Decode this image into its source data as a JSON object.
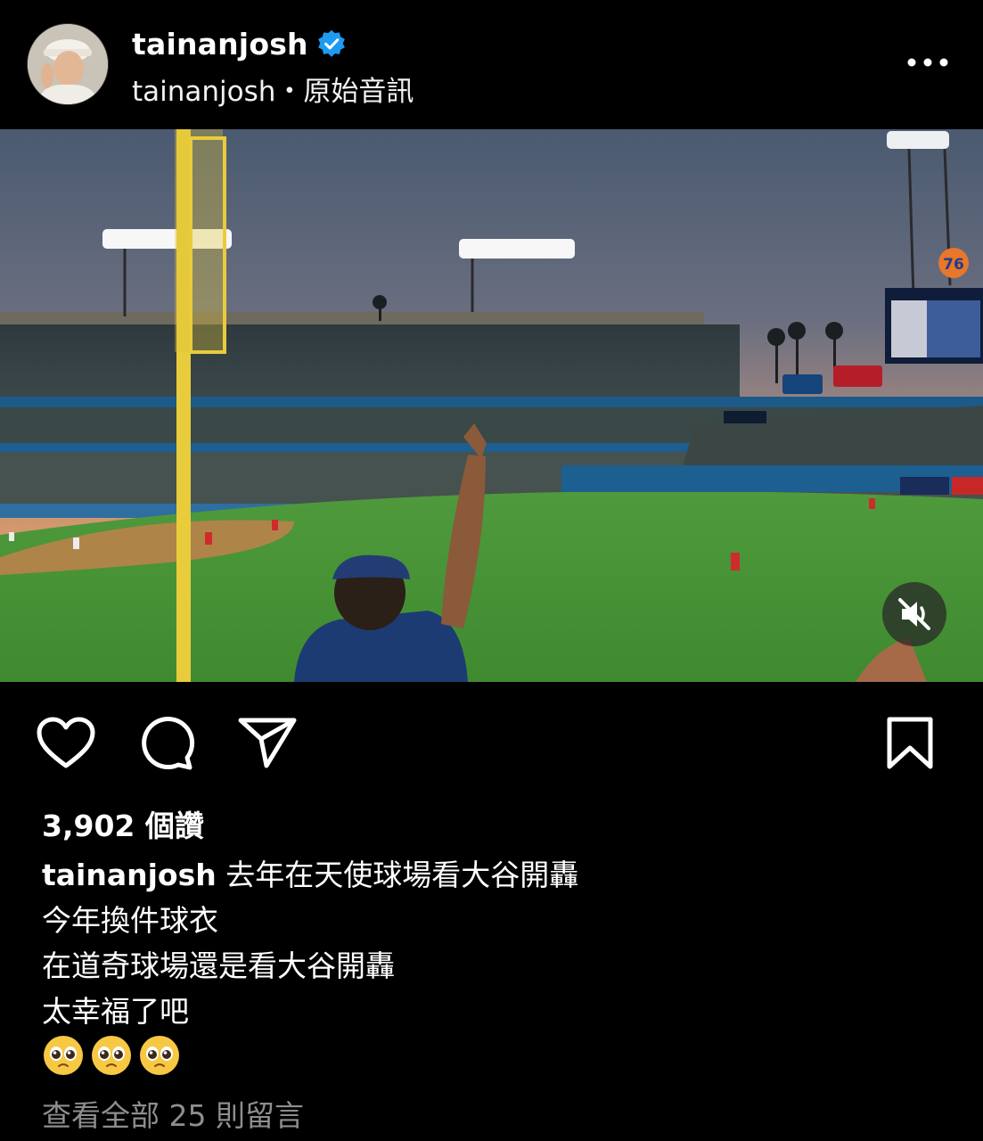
{
  "post": {
    "username": "tainanjosh",
    "verified": true,
    "audio_line": "tainanjosh・原始音訊",
    "more_icon": "more-horizontal-icon"
  },
  "media": {
    "type": "video",
    "scene": "night baseball stadium, fan pointing up near yellow foul pole",
    "muted": true,
    "mute_icon": "speaker-muted-icon"
  },
  "actions": {
    "like_icon": "heart-icon",
    "comment_icon": "comment-bubble-icon",
    "share_icon": "paper-plane-icon",
    "save_icon": "bookmark-icon"
  },
  "likes_text": "3,902 個讚",
  "caption": {
    "username": "tainanjosh",
    "lines": [
      "去年在天使球場看大谷開轟",
      "今年換件球衣",
      "在道奇球場還是看大谷開轟",
      "太幸福了吧"
    ],
    "emoji": "🥺🥺🥺"
  },
  "view_comments": "查看全部 25 則留言",
  "colors": {
    "background": "#000000",
    "verified": "#1d9bf0",
    "muted_text": "#8e8e8e"
  }
}
